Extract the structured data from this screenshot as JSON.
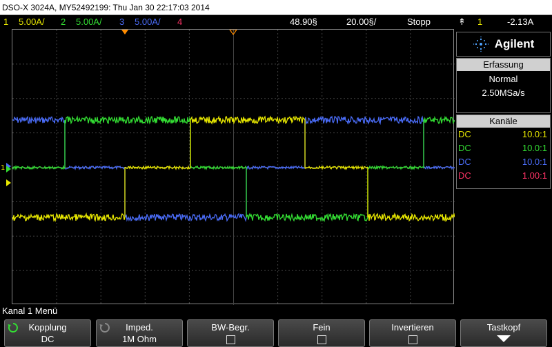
{
  "window": {
    "title": "DSO-X 3024A, MY52492199: Thu Jan 30 22:17:03 2014"
  },
  "status": {
    "channels": [
      {
        "num": "1",
        "scale": "5.00A/",
        "color": "#e8e800"
      },
      {
        "num": "2",
        "scale": "5.00A/",
        "color": "#33dd33"
      },
      {
        "num": "3",
        "scale": "5.00A/",
        "color": "#4a6cf7"
      },
      {
        "num": "4",
        "scale": "",
        "color": "#ff3366"
      }
    ],
    "time_pos": "48.90§",
    "time_scale": "20.00§/",
    "run_state": "Stopp",
    "trigger_source": "1",
    "trigger_level": "-2.13A"
  },
  "panel": {
    "brand": "Agilent",
    "acquisition": {
      "title": "Erfassung",
      "mode": "Normal",
      "rate": "2.50MSa/s"
    },
    "channels": {
      "title": "Kanäle",
      "rows": [
        {
          "coupling": "DC",
          "probe": "10.0:1",
          "color": "#e8e800"
        },
        {
          "coupling": "DC",
          "probe": "10.0:1",
          "color": "#33dd33"
        },
        {
          "coupling": "DC",
          "probe": "10.0:1",
          "color": "#4a6cf7"
        },
        {
          "coupling": "DC",
          "probe": "1.00:1",
          "color": "#ff3366"
        }
      ]
    }
  },
  "menu": {
    "title": "Kanal 1 Menü",
    "softkeys": [
      {
        "label": "Kopplung",
        "value": "DC",
        "icon": "rotate-knob-icon",
        "icon_color": "#33dd33"
      },
      {
        "label": "Imped.",
        "value": "1M Ohm",
        "icon": "rotate-knob-icon",
        "icon_color": "#888888"
      },
      {
        "label": "BW-Begr.",
        "value": ""
      },
      {
        "label": "Fein",
        "value": ""
      },
      {
        "label": "Invertieren",
        "value": ""
      },
      {
        "label": "Tastkopf",
        "value": ""
      }
    ]
  },
  "colors": {
    "ch1": "#e8e800",
    "ch2": "#33dd33",
    "ch3": "#4a6cf7",
    "ch4": "#ff3366",
    "trigger_marker": "#ff8c00"
  }
}
